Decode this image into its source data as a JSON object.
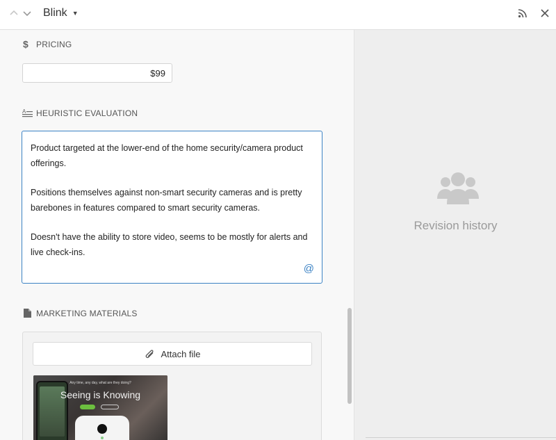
{
  "header": {
    "record_name": "Blink",
    "prev_icon": "chevron-up-icon",
    "next_icon": "chevron-down-icon",
    "caret_icon": "caret-down-icon",
    "feed_icon": "rss-icon",
    "close_icon": "close-icon"
  },
  "fields": {
    "pricing": {
      "label": "PRICING",
      "icon": "currency-icon",
      "value": "$99"
    },
    "heuristic": {
      "label": "HEURISTIC EVALUATION",
      "icon": "long-text-icon",
      "paragraphs": [
        "Product targeted at the lower-end of the home security/camera product offerings.",
        "Positions themselves against non-smart security cameras and is pretty barebones in features compared to smart security cameras.",
        "Doesn't have the ability to store video, seems to be mostly for alerts and live check-ins."
      ],
      "mention_symbol": "@"
    },
    "marketing": {
      "label": "MARKETING MATERIALS",
      "icon": "document-icon",
      "attach_label": "Attach file",
      "attach_icon": "paperclip-icon",
      "thumbnail": {
        "headline": "Seeing is Knowing",
        "small_text": "Any time, any day, what are they doing?"
      }
    }
  },
  "revision": {
    "label": "Revision history",
    "icon": "users-icon"
  },
  "colors": {
    "accent": "#3b82c4",
    "panel_left": "#f8f8f8",
    "panel_right": "#eeeeee"
  }
}
